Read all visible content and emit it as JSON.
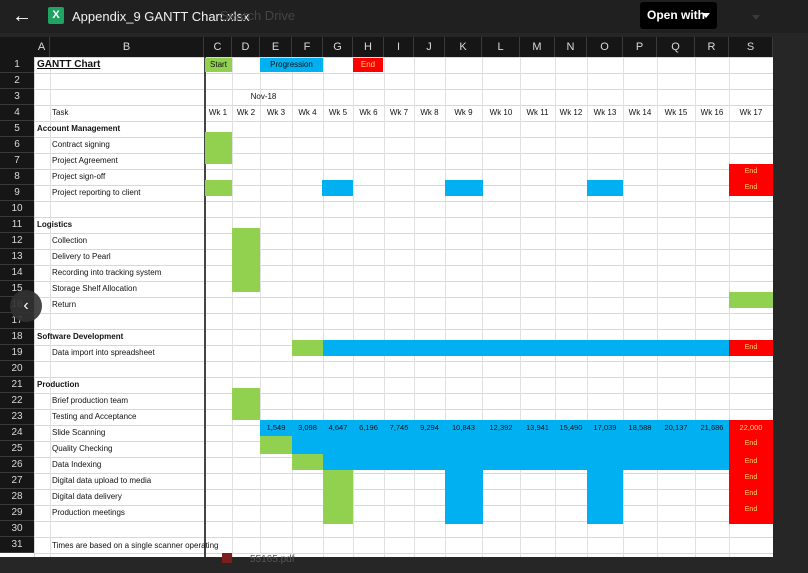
{
  "topbar": {
    "back_icon": "arrow-left-icon",
    "file_type_label": "X",
    "file_title": "Appendix_9 GANTT Chart.xlsx",
    "search_placeholder": "Search Drive",
    "open_with_label": "Open with",
    "open_with_icon": "caret-down-icon"
  },
  "columns": [
    "A",
    "B",
    "C",
    "D",
    "E",
    "F",
    "G",
    "H",
    "I",
    "J",
    "K",
    "L",
    "M",
    "N",
    "O",
    "P",
    "Q",
    "R",
    "S"
  ],
  "rows": [
    "1",
    "2",
    "3",
    "4",
    "5",
    "6",
    "7",
    "8",
    "9",
    "10",
    "11",
    "12",
    "13",
    "14",
    "15",
    "16",
    "17",
    "18",
    "19",
    "20",
    "21",
    "22",
    "23",
    "24",
    "25",
    "26",
    "27",
    "28",
    "29",
    "30",
    "31"
  ],
  "sheet": {
    "title": "GANTT Chart",
    "legend": {
      "start": "Start",
      "progression": "Progression",
      "end": "End"
    },
    "month": "Nov-18",
    "task_header": "Task",
    "weeks": [
      "Wk 1",
      "Wk 2",
      "Wk 3",
      "Wk 4",
      "Wk 5",
      "Wk 6",
      "Wk 7",
      "Wk 8",
      "Wk 9",
      "Wk 10",
      "Wk 11",
      "Wk 12",
      "Wk 13",
      "Wk 14",
      "Wk 15",
      "Wk 16",
      "Wk 17"
    ],
    "sections": {
      "account": "Account Management",
      "logistics": "Logistics",
      "software": "Software Development",
      "production": "Production"
    },
    "tasks": {
      "contract": "Contract signing",
      "agreement": "Project Agreement",
      "signoff": "Project sign-off",
      "reporting": "Project reporting to client",
      "collection": "Collection",
      "delivery_pearl": "Delivery to Pearl",
      "recording": "Recording into tracking system",
      "storage": "Storage Shelf Allocation",
      "return": "Return",
      "data_import": "Data import into spreadsheet",
      "brief": "Brief production team",
      "testing": "Testing and Acceptance",
      "scanning": "Slide Scanning",
      "quality": "Quality Checking",
      "indexing": "Data Indexing",
      "upload": "Digital data upload to media",
      "delivery": "Digital data delivery",
      "meetings": "Production meetings"
    },
    "scanning_values": [
      "1,549",
      "3,098",
      "4,647",
      "6,196",
      "7,745",
      "9,294",
      "10,843",
      "12,392",
      "13,941",
      "15,490",
      "17,039",
      "18,588",
      "20,137",
      "21,686",
      "22,000"
    ],
    "end_label": "End",
    "footnote": "Times are based on a single scanner operating"
  },
  "colors": {
    "start": "#92d050",
    "progression": "#00b0f0",
    "end": "#ff0000",
    "end_text": "#ffd966"
  },
  "nav": {
    "prev_icon": "chevron-left-icon"
  },
  "background_file": {
    "name": "55165.pdf"
  }
}
